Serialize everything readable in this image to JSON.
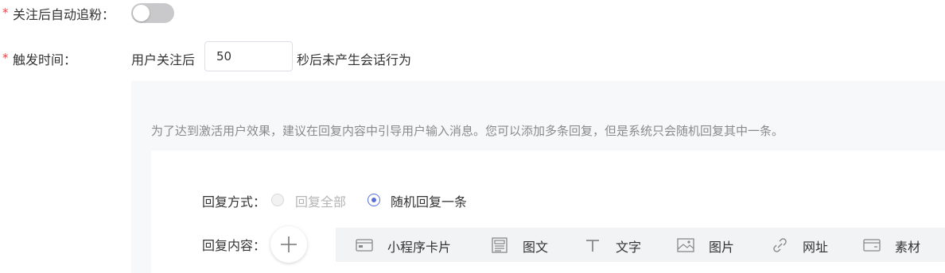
{
  "auto_follow": {
    "required_mark": "*",
    "label": "关注后自动追粉：",
    "enabled": false
  },
  "trigger": {
    "required_mark": "*",
    "label": "触发时间：",
    "prefix": "用户关注后",
    "seconds": "50",
    "suffix": "秒后未产生会话行为"
  },
  "hint": "为了达到激活用户效果，建议在回复内容中引导用户输入消息。您可以添加多条回复，但是系统只会随机回复其中一条。",
  "reply_mode": {
    "label": "回复方式：",
    "options": [
      {
        "label": "回复全部",
        "selected": false,
        "disabled": true
      },
      {
        "label": "随机回复一条",
        "selected": true,
        "disabled": false
      }
    ]
  },
  "reply_content": {
    "label": "回复内容：",
    "tools": [
      {
        "icon": "mini-program-card-icon",
        "label": "小程序卡片"
      },
      {
        "icon": "article-icon",
        "label": "图文"
      },
      {
        "icon": "text-icon",
        "label": "文字"
      },
      {
        "icon": "image-icon",
        "label": "图片"
      },
      {
        "icon": "link-icon",
        "label": "网址"
      },
      {
        "icon": "material-icon",
        "label": "素材"
      }
    ]
  },
  "colors": {
    "required": "#e6454a",
    "accent": "#5b6fd6",
    "toggle_off": "#c9c9cc",
    "panel_bg": "#f7f8fa",
    "toolbar_bg": "#f2f3f5"
  }
}
